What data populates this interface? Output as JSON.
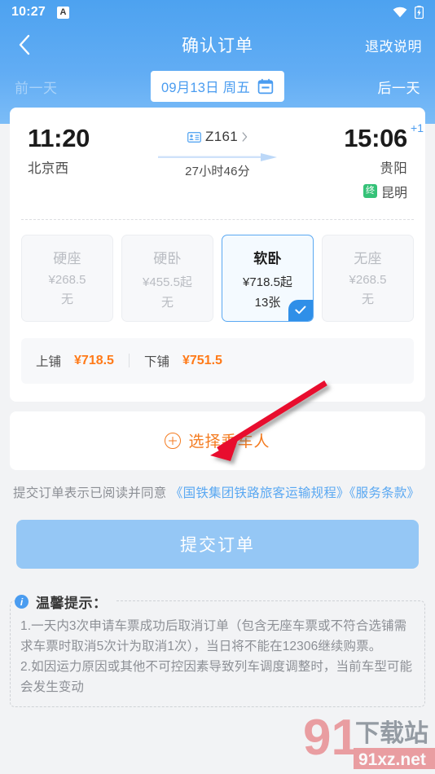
{
  "status_bar": {
    "time": "10:27",
    "app_icon_letter": "A",
    "wifi_icon": "wifi-icon",
    "battery_icon": "battery-charging-icon"
  },
  "nav": {
    "back_icon": "chevron-left-icon",
    "title": "确认订单",
    "action_label": "退改说明"
  },
  "date_strip": {
    "prev_label": "前一天",
    "next_label": "后一天",
    "date_text": "09月13日 周五",
    "calendar_icon": "calendar-icon"
  },
  "trip": {
    "depart_time": "11:20",
    "depart_station": "北京西",
    "train_icon": "id-card-icon",
    "train_no": "Z161",
    "train_chevron_icon": "chevron-right-icon",
    "duration": "27小时46分",
    "arrive_time": "15:06",
    "arrive_day_offset": "+1",
    "arrive_station": "贵阳",
    "terminal_badge": "终",
    "terminal_station": "昆明"
  },
  "seat_classes": [
    {
      "name": "硬座",
      "price": "¥268.5",
      "count": "无",
      "selected": false
    },
    {
      "name": "硬卧",
      "price": "¥455.5起",
      "count": "无",
      "selected": false
    },
    {
      "name": "软卧",
      "price": "¥718.5起",
      "count": "13张",
      "selected": true
    },
    {
      "name": "无座",
      "price": "¥268.5",
      "count": "无",
      "selected": false
    }
  ],
  "berths": [
    {
      "label": "上铺",
      "price": "¥718.5"
    },
    {
      "label": "下铺",
      "price": "¥751.5"
    }
  ],
  "passenger": {
    "add_icon": "plus-circle-icon",
    "add_label": "选择乘车人"
  },
  "terms": {
    "prefix": "提交订单表示已阅读并同意 ",
    "link1": "《国铁集团铁路旅客运输规程》",
    "link2": "《服务条款》"
  },
  "submit": {
    "label": "提交订单"
  },
  "tips": {
    "icon": "info-icon",
    "title": "温馨提示：",
    "lines": [
      "1.一天内3次申请车票成功后取消订单（包含无座车票或不符合选铺需求车票时取消5次计为取消1次），当日将不能在12306继续购票。",
      "2.如因运力原因或其他不可控因素导致列车调度调整时，当前车型可能会发生变动"
    ]
  },
  "annotation": {
    "arrow_color": "#e8112d",
    "arrow_name": "red-pointer-arrow"
  },
  "watermark": {
    "mark_cn": "下载站",
    "mark_url": "91xz.net",
    "mark_digit": "91"
  },
  "colors": {
    "header_blue": "#62adf4",
    "accent_blue": "#4a9cf0",
    "orange": "#f47b20",
    "price_orange": "#ff7a18",
    "green": "#35c278",
    "page_bg": "#f2f3f5"
  }
}
